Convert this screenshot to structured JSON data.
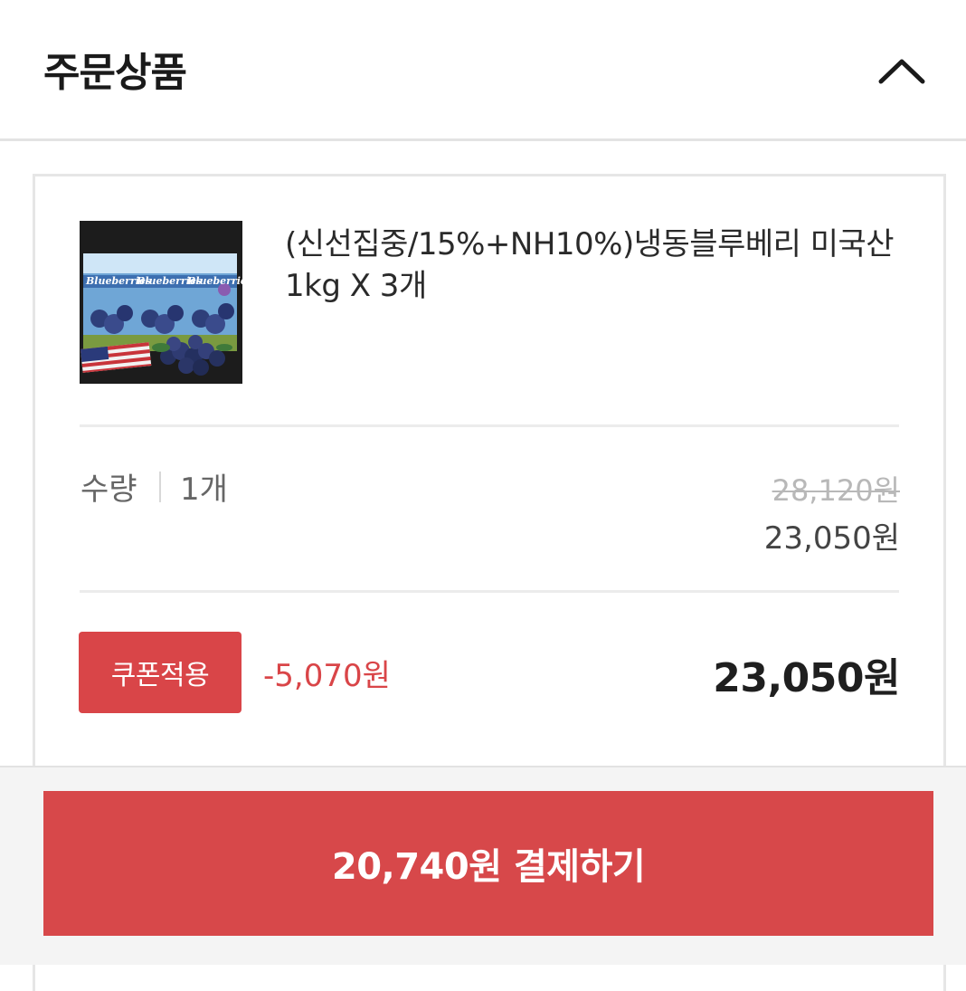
{
  "header": {
    "title": "주문상품",
    "collapse_icon": "chevron-up-icon"
  },
  "product": {
    "image_label": "Blueberries",
    "name": "(신선집중/15%+NH10%)냉동블루베리 미국산 1kg X 3개",
    "quantity_label": "수량",
    "quantity_value": "1개",
    "original_price": "28,120원",
    "sale_price": "23,050원"
  },
  "coupon": {
    "button_label": "쿠폰적용",
    "discount": "-5,070원"
  },
  "total_price": "23,050원",
  "pay": {
    "button_label": "20,740원 결제하기"
  },
  "colors": {
    "accent": "#d7484a",
    "text_dark": "#1f1f1f",
    "text_muted": "#666666"
  }
}
